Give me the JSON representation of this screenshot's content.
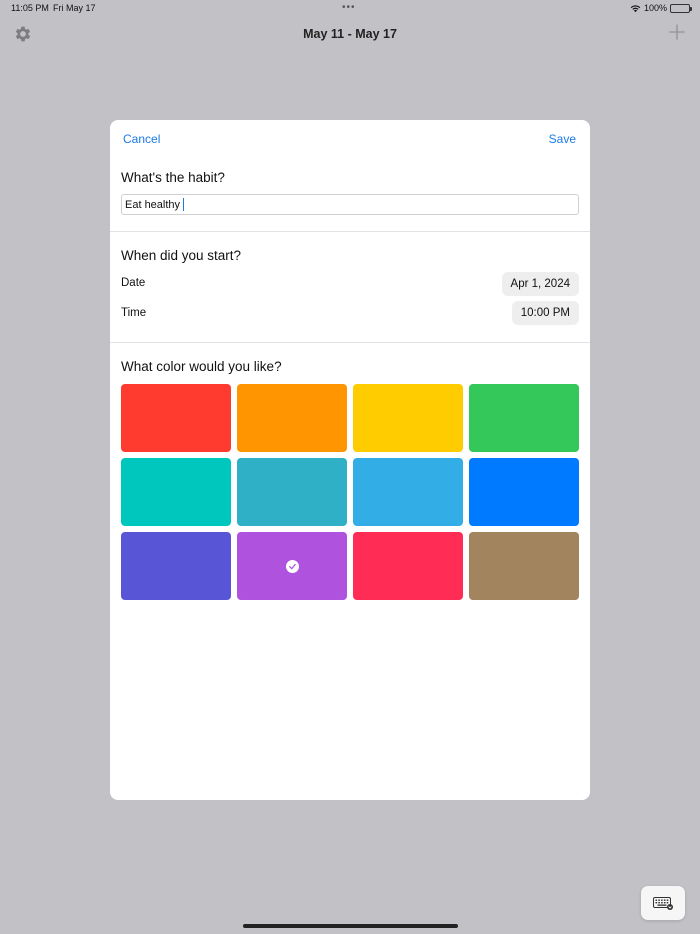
{
  "status_bar": {
    "time": "11:05 PM",
    "date": "Fri May 17",
    "battery": "100%"
  },
  "nav": {
    "title": "May 11 - May 17",
    "icons": [
      "gear-icon",
      "plus-icon"
    ]
  },
  "modal": {
    "cancel_label": "Cancel",
    "save_label": "Save",
    "habit_question": "What's the habit?",
    "habit_value": "Eat healthy",
    "start_question": "When did you start?",
    "date_label": "Date",
    "date_value": "Apr 1, 2024",
    "time_label": "Time",
    "time_value": "10:00 PM",
    "color_question": "What color would you like?",
    "colors": [
      "#ff3b30",
      "#ff9500",
      "#ffcc00",
      "#34c759",
      "#00c7be",
      "#30b0c7",
      "#32ade6",
      "#007aff",
      "#5856d6",
      "#af52de",
      "#ff2d55",
      "#a2845e"
    ],
    "selected_color": "#af52de"
  },
  "keyboard_button_icon": "keyboard-icon"
}
